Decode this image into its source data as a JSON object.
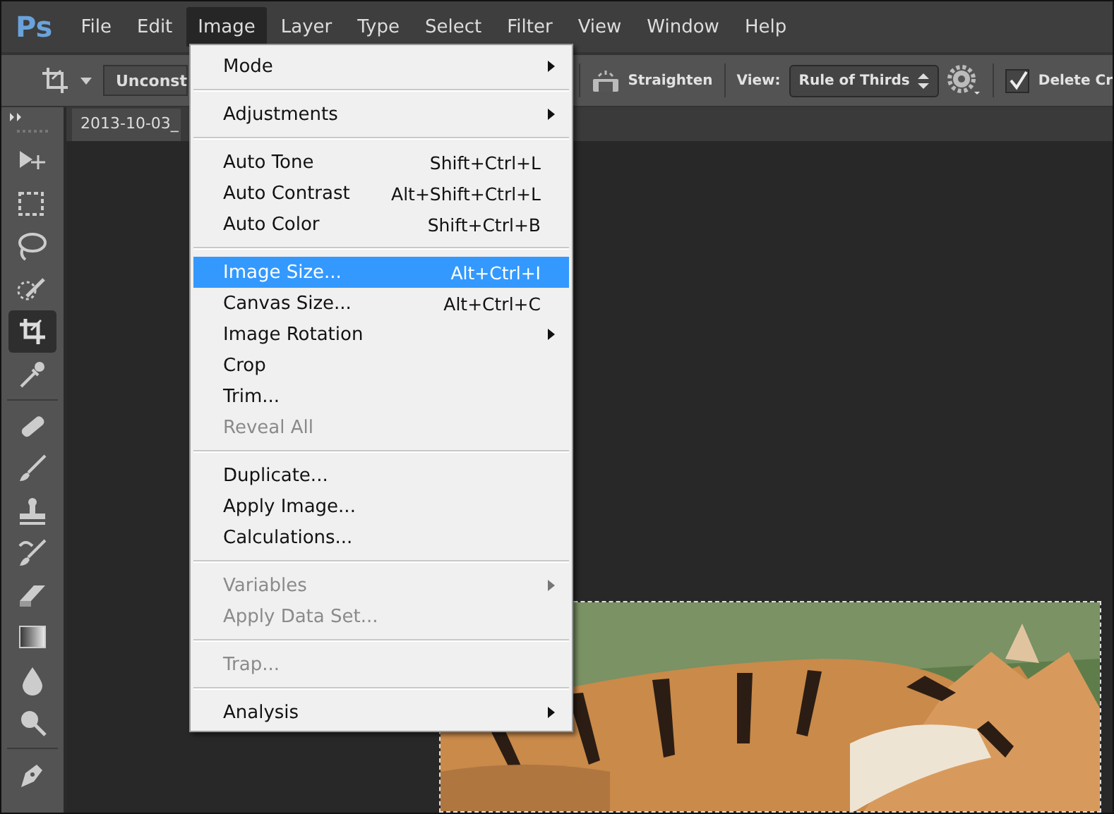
{
  "menu_bar": {
    "logo": "Ps",
    "items": [
      {
        "label": "File",
        "selected": false
      },
      {
        "label": "Edit",
        "selected": false
      },
      {
        "label": "Image",
        "selected": true
      },
      {
        "label": "Layer",
        "selected": false
      },
      {
        "label": "Type",
        "selected": false
      },
      {
        "label": "Select",
        "selected": false
      },
      {
        "label": "Filter",
        "selected": false
      },
      {
        "label": "View",
        "selected": false
      },
      {
        "label": "Window",
        "selected": false
      },
      {
        "label": "Help",
        "selected": false
      }
    ]
  },
  "options_bar": {
    "ratio": "Unconst",
    "straighten": "Straighten",
    "view_label": "View:",
    "view_value": "Rule of Thirds",
    "delete_checked": true,
    "delete_label": "Delete Cr"
  },
  "document_tab": {
    "title": "2013-10-03_"
  },
  "tools": [
    {
      "kind": "move",
      "selected": false
    },
    {
      "kind": "marquee",
      "selected": false
    },
    {
      "kind": "lasso",
      "selected": false
    },
    {
      "kind": "quick",
      "selected": false
    },
    {
      "kind": "crop",
      "selected": true
    },
    {
      "kind": "eyedropper",
      "selected": false
    },
    {
      "kind": "sep"
    },
    {
      "kind": "healing",
      "selected": false
    },
    {
      "kind": "brush",
      "selected": false
    },
    {
      "kind": "stamp",
      "selected": false
    },
    {
      "kind": "history",
      "selected": false
    },
    {
      "kind": "eraser",
      "selected": false
    },
    {
      "kind": "gradient",
      "selected": false
    },
    {
      "kind": "blur",
      "selected": false
    },
    {
      "kind": "dodge",
      "selected": false
    },
    {
      "kind": "sep"
    },
    {
      "kind": "pen",
      "selected": false
    }
  ],
  "image_menu": {
    "groups": [
      [
        {
          "label": "Mode",
          "submenu": true,
          "disabled": false,
          "selected": false
        }
      ],
      [
        {
          "label": "Adjustments",
          "submenu": true,
          "disabled": false,
          "selected": false
        }
      ],
      [
        {
          "label": "Auto Tone",
          "shortcut": "Shift+Ctrl+L",
          "submenu": false,
          "disabled": false,
          "selected": false
        },
        {
          "label": "Auto Contrast",
          "shortcut": "Alt+Shift+Ctrl+L",
          "submenu": false,
          "disabled": false,
          "selected": false
        },
        {
          "label": "Auto Color",
          "shortcut": "Shift+Ctrl+B",
          "submenu": false,
          "disabled": false,
          "selected": false
        }
      ],
      [
        {
          "label": "Image Size...",
          "shortcut": "Alt+Ctrl+I",
          "submenu": false,
          "disabled": false,
          "selected": true
        },
        {
          "label": "Canvas Size...",
          "shortcut": "Alt+Ctrl+C",
          "submenu": false,
          "disabled": false,
          "selected": false
        },
        {
          "label": "Image Rotation",
          "submenu": true,
          "disabled": false,
          "selected": false
        },
        {
          "label": "Crop",
          "submenu": false,
          "disabled": false,
          "selected": false
        },
        {
          "label": "Trim...",
          "submenu": false,
          "disabled": false,
          "selected": false
        },
        {
          "label": "Reveal All",
          "submenu": false,
          "disabled": true,
          "selected": false
        }
      ],
      [
        {
          "label": "Duplicate...",
          "submenu": false,
          "disabled": false,
          "selected": false
        },
        {
          "label": "Apply Image...",
          "submenu": false,
          "disabled": false,
          "selected": false
        },
        {
          "label": "Calculations...",
          "submenu": false,
          "disabled": false,
          "selected": false
        }
      ],
      [
        {
          "label": "Variables",
          "submenu": true,
          "disabled": true,
          "selected": false
        },
        {
          "label": "Apply Data Set...",
          "submenu": false,
          "disabled": true,
          "selected": false
        }
      ],
      [
        {
          "label": "Trap...",
          "submenu": false,
          "disabled": true,
          "selected": false
        }
      ],
      [
        {
          "label": "Analysis",
          "submenu": true,
          "disabled": false,
          "selected": false
        }
      ]
    ]
  }
}
